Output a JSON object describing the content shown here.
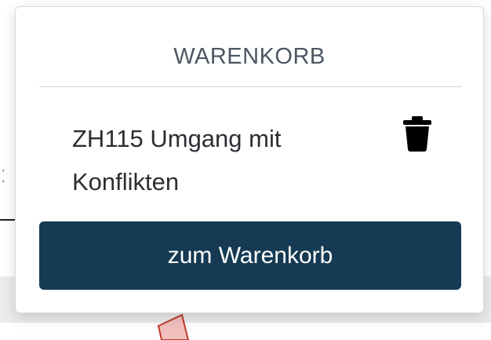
{
  "cart": {
    "title": "WARENKORB",
    "items": [
      {
        "name": "ZH115 Umgang mit Konflikten",
        "delete_icon": "trash-icon"
      }
    ],
    "button_label": "zum Warenkorb"
  },
  "colors": {
    "button_bg": "#163a53",
    "button_text": "#ffffff",
    "title_text": "#4d5661",
    "item_text": "#2b2f33"
  }
}
